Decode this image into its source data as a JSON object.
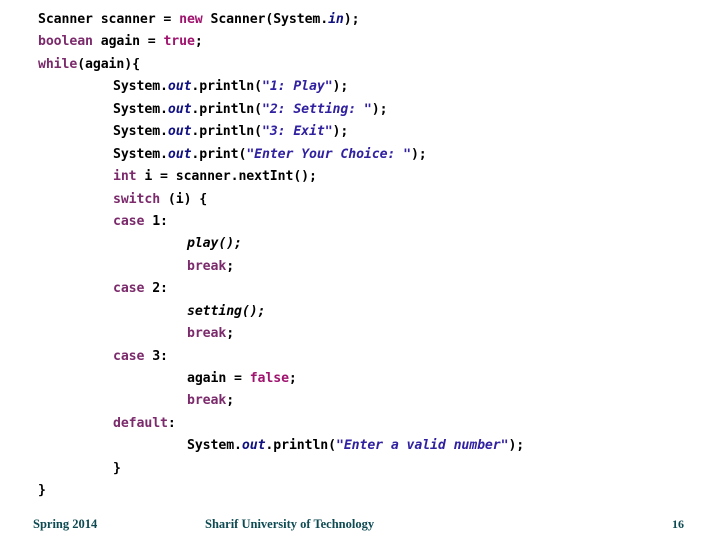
{
  "slide": {
    "background_color": "#ffffff",
    "code_block": {
      "language": "java",
      "colors": {
        "keyword": "#7b2a6b",
        "literal": "#a0136e",
        "string": "#3021a0",
        "field": "#101080",
        "plain": "#000000"
      },
      "lines": [
        {
          "indent": 0,
          "tokens": [
            {
              "t": "Scanner scanner = ",
              "c": "plain"
            },
            {
              "t": "new",
              "c": "kw2"
            },
            {
              "t": " Scanner(System.",
              "c": "plain"
            },
            {
              "t": "in",
              "c": "fld"
            },
            {
              "t": ");",
              "c": "plain"
            }
          ]
        },
        {
          "indent": 0,
          "tokens": [
            {
              "t": "boolean",
              "c": "kw"
            },
            {
              "t": " again = ",
              "c": "plain"
            },
            {
              "t": "true",
              "c": "kw2"
            },
            {
              "t": ";",
              "c": "plain"
            }
          ]
        },
        {
          "indent": 0,
          "tokens": [
            {
              "t": "while",
              "c": "kw"
            },
            {
              "t": "(again){",
              "c": "plain"
            }
          ]
        },
        {
          "indent": 1,
          "tokens": [
            {
              "t": "System.",
              "c": "plain"
            },
            {
              "t": "out",
              "c": "fld"
            },
            {
              "t": ".println(",
              "c": "plain"
            },
            {
              "t": "\"1: Play\"",
              "c": "str"
            },
            {
              "t": ");",
              "c": "plain"
            }
          ]
        },
        {
          "indent": 1,
          "tokens": [
            {
              "t": "System.",
              "c": "plain"
            },
            {
              "t": "out",
              "c": "fld"
            },
            {
              "t": ".println(",
              "c": "plain"
            },
            {
              "t": "\"2: Setting: \"",
              "c": "str"
            },
            {
              "t": ");",
              "c": "plain"
            }
          ]
        },
        {
          "indent": 1,
          "tokens": [
            {
              "t": "System.",
              "c": "plain"
            },
            {
              "t": "out",
              "c": "fld"
            },
            {
              "t": ".println(",
              "c": "plain"
            },
            {
              "t": "\"3: Exit\"",
              "c": "str"
            },
            {
              "t": ");",
              "c": "plain"
            }
          ]
        },
        {
          "indent": 1,
          "tokens": [
            {
              "t": "System.",
              "c": "plain"
            },
            {
              "t": "out",
              "c": "fld"
            },
            {
              "t": ".print(",
              "c": "plain"
            },
            {
              "t": "\"Enter Your Choice: \"",
              "c": "str"
            },
            {
              "t": ");",
              "c": "plain"
            }
          ]
        },
        {
          "indent": 1,
          "tokens": [
            {
              "t": "int",
              "c": "kw"
            },
            {
              "t": " i = scanner.nextInt();",
              "c": "plain"
            }
          ]
        },
        {
          "indent": 1,
          "tokens": [
            {
              "t": "switch",
              "c": "kw"
            },
            {
              "t": " (i) {",
              "c": "plain"
            }
          ]
        },
        {
          "indent": 1,
          "tokens": [
            {
              "t": "case",
              "c": "kw"
            },
            {
              "t": " 1:",
              "c": "plain"
            }
          ]
        },
        {
          "indent": 2,
          "tokens": [
            {
              "t": "play();",
              "c": "mth"
            }
          ]
        },
        {
          "indent": 2,
          "tokens": [
            {
              "t": "break",
              "c": "kw"
            },
            {
              "t": ";",
              "c": "plain"
            }
          ]
        },
        {
          "indent": 1,
          "tokens": [
            {
              "t": "case",
              "c": "kw"
            },
            {
              "t": " 2:",
              "c": "plain"
            }
          ]
        },
        {
          "indent": 2,
          "tokens": [
            {
              "t": "setting();",
              "c": "mth"
            }
          ]
        },
        {
          "indent": 2,
          "tokens": [
            {
              "t": "break",
              "c": "kw"
            },
            {
              "t": ";",
              "c": "plain"
            }
          ]
        },
        {
          "indent": 1,
          "tokens": [
            {
              "t": "case",
              "c": "kw"
            },
            {
              "t": " 3:",
              "c": "plain"
            }
          ]
        },
        {
          "indent": 2,
          "tokens": [
            {
              "t": "again = ",
              "c": "plain"
            },
            {
              "t": "false",
              "c": "kw2"
            },
            {
              "t": ";",
              "c": "plain"
            }
          ]
        },
        {
          "indent": 2,
          "tokens": [
            {
              "t": "break",
              "c": "kw"
            },
            {
              "t": ";",
              "c": "plain"
            }
          ]
        },
        {
          "indent": 1,
          "tokens": [
            {
              "t": "default",
              "c": "kw"
            },
            {
              "t": ":",
              "c": "plain"
            }
          ]
        },
        {
          "indent": 2,
          "tokens": [
            {
              "t": "System.",
              "c": "plain"
            },
            {
              "t": "out",
              "c": "fld"
            },
            {
              "t": ".println(",
              "c": "plain"
            },
            {
              "t": "\"Enter a valid number\"",
              "c": "str"
            },
            {
              "t": ");",
              "c": "plain"
            }
          ]
        },
        {
          "indent": 1,
          "tokens": [
            {
              "t": "}",
              "c": "plain"
            }
          ]
        },
        {
          "indent": 0,
          "tokens": [
            {
              "t": "}",
              "c": "plain"
            }
          ]
        }
      ]
    },
    "footer": {
      "left": "Spring 2014",
      "center": "Sharif University of Technology",
      "page_number": "16",
      "color": "#0d4a52"
    }
  }
}
